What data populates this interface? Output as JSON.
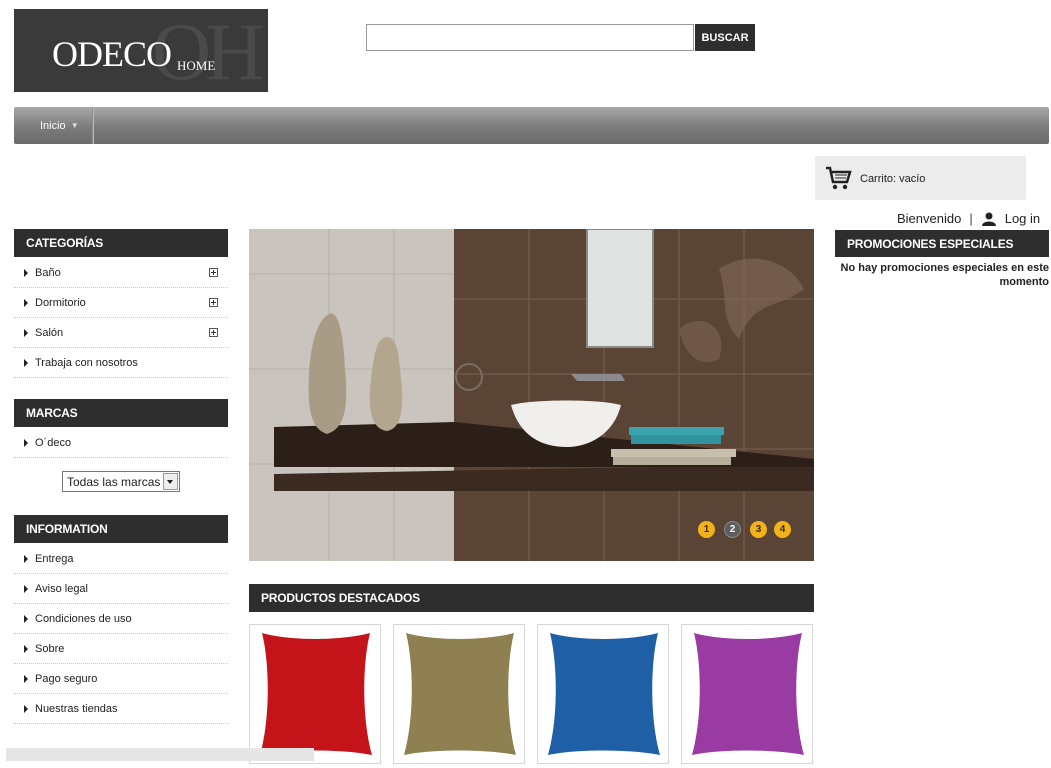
{
  "header": {
    "logo_text": "ODECO",
    "logo_sub": "HOME",
    "logo_mark": "OH",
    "search": {
      "value": "",
      "placeholder": "",
      "button": "BUSCAR"
    }
  },
  "nav": {
    "items": [
      {
        "label": "Inicio",
        "icon": "caret-down-icon"
      }
    ]
  },
  "cart": {
    "icon": "cart-icon",
    "label": "Carrito: vacío"
  },
  "account": {
    "welcome": "Bienvenido",
    "separator": "|",
    "login": "Log in",
    "icon": "user-icon"
  },
  "sidebar": {
    "categories": {
      "title": "CATEGORÍAS",
      "items": [
        {
          "label": "Baño",
          "expandable": true
        },
        {
          "label": "Dormitorio",
          "expandable": true
        },
        {
          "label": "Salón",
          "expandable": true
        },
        {
          "label": "Trabaja con nosotros",
          "expandable": false
        }
      ]
    },
    "brands": {
      "title": "MARCAS",
      "items": [
        {
          "label": "O´deco"
        }
      ],
      "select_value": "Todas las marcas"
    },
    "information": {
      "title": "INFORMATION",
      "items": [
        {
          "label": "Entrega"
        },
        {
          "label": "Aviso legal"
        },
        {
          "label": "Condiciones de uso"
        },
        {
          "label": "Sobre"
        },
        {
          "label": "Pago seguro"
        },
        {
          "label": "Nuestras tiendas"
        }
      ]
    }
  },
  "slider": {
    "dots": [
      {
        "label": "1",
        "active": false
      },
      {
        "label": "2",
        "active": true
      },
      {
        "label": "3",
        "active": false
      },
      {
        "label": "4",
        "active": false
      }
    ]
  },
  "featured": {
    "title": "PRODUCTOS DESTACADOS",
    "products": [
      {
        "color": "#c4141a"
      },
      {
        "color": "#8f8052"
      },
      {
        "color": "#1f5fa6"
      },
      {
        "color": "#9a3aa3"
      }
    ]
  },
  "promotions": {
    "title": "PROMOCIONES ESPECIALES",
    "message": "No hay promociones especiales en este momento"
  },
  "colors": {
    "header_dark": "#2e2e2e",
    "accent_yellow": "#f2b21b"
  }
}
